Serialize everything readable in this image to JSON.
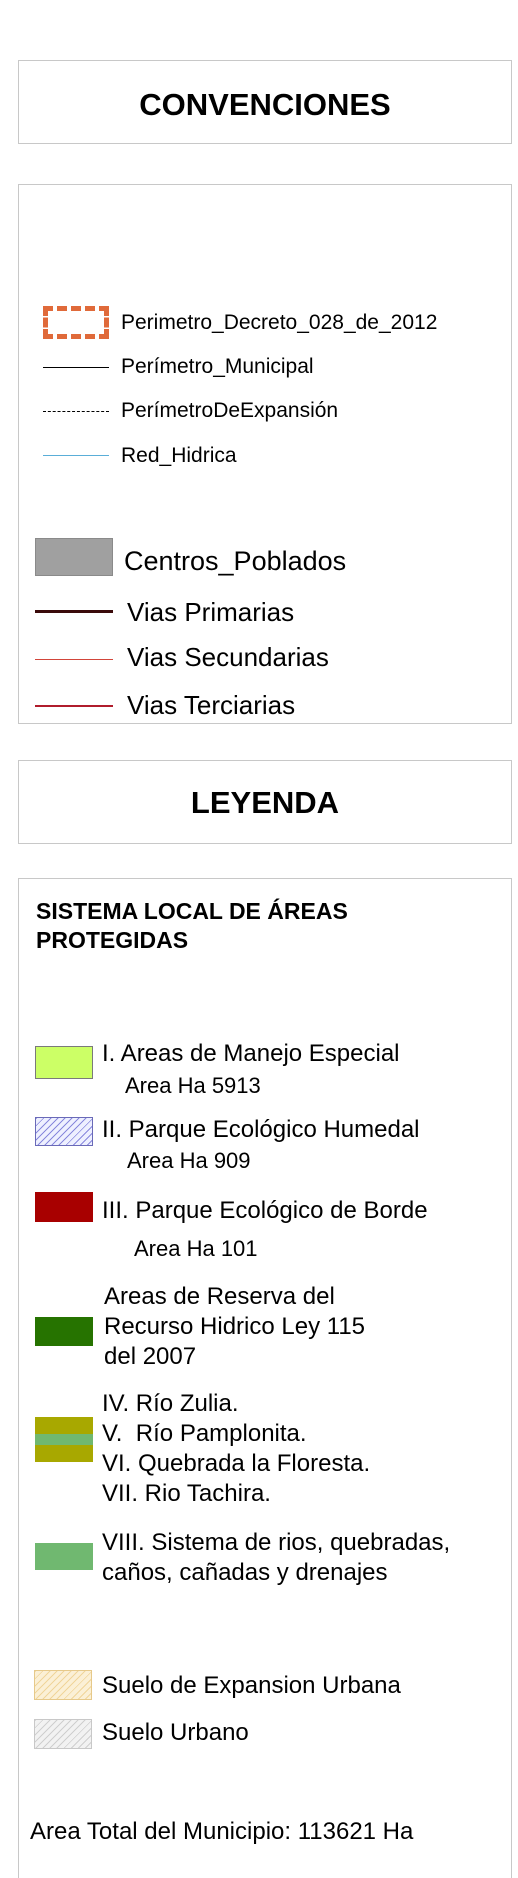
{
  "convenciones": {
    "title": "CONVENCIONES",
    "items": [
      {
        "label": "Perimetro_Decreto_028_de_2012",
        "symbol": "dashed-orange-rect",
        "color": "#e06a3a"
      },
      {
        "label": "Perímetro_Municipal",
        "symbol": "solid-thin-black-line",
        "color": "#000000"
      },
      {
        "label": "PerímetroDeExpansión",
        "symbol": "dash-dot-black-line",
        "color": "#000000"
      },
      {
        "label": "Red_Hidrica",
        "symbol": "thin-blue-line",
        "color": "#5aaed8"
      },
      {
        "label": "Centros_Poblados",
        "symbol": "gray-fill",
        "color": "#a0a0a0"
      },
      {
        "label": "Vias Primarias",
        "symbol": "dark-brown-line",
        "color": "#3a0a0a"
      },
      {
        "label": "Vias Secundarias",
        "symbol": "red-line",
        "color": "#d2453a"
      },
      {
        "label": "Vias Terciarias",
        "symbol": "dark-red-line",
        "color": "#b01c2c"
      }
    ]
  },
  "leyenda": {
    "title": "LEYENDA",
    "section_title_line1": "SISTEMA LOCAL DE ÁREAS",
    "section_title_line2": "PROTEGIDAS",
    "items": [
      {
        "lines": [
          "I. Areas de Manejo Especial",
          "Area Ha 5913"
        ],
        "symbol": "light-green-fill",
        "color": "#ccff66"
      },
      {
        "lines": [
          "II. Parque Ecológico Humedal",
          "Area Ha 909"
        ],
        "symbol": "blue-hatch",
        "color": "#8888dd"
      },
      {
        "lines": [
          "III. Parque Ecológico de Borde",
          "Area Ha 101"
        ],
        "symbol": "dark-red-fill",
        "color": "#a80000"
      },
      {
        "lines": [
          "Areas de Reserva del",
          "Recurso Hidrico Ley 115",
          "del 2007"
        ],
        "symbol": "dark-green-fill",
        "color": "#267300"
      },
      {
        "lines": [
          "IV. Río Zulia.",
          "V.  Río Pamplonita.",
          "VI. Quebrada la Floresta.",
          "VII. Rio Tachira."
        ],
        "symbol": "olive-with-green-band",
        "color": "#a8a800"
      },
      {
        "lines": [
          "VIII. Sistema de rios, quebradas,",
          "caños, cañadas y drenajes"
        ],
        "symbol": "green-fill",
        "color": "#70b870"
      },
      {
        "lines": [
          "Suelo de Expansion Urbana"
        ],
        "symbol": "beige-hatch",
        "color": "#f5deb0"
      },
      {
        "lines": [
          "Suelo Urbano"
        ],
        "symbol": "gray-hatch",
        "color": "#e6e6e6"
      }
    ],
    "total": "Area Total del Municipio: 113621 Ha"
  }
}
